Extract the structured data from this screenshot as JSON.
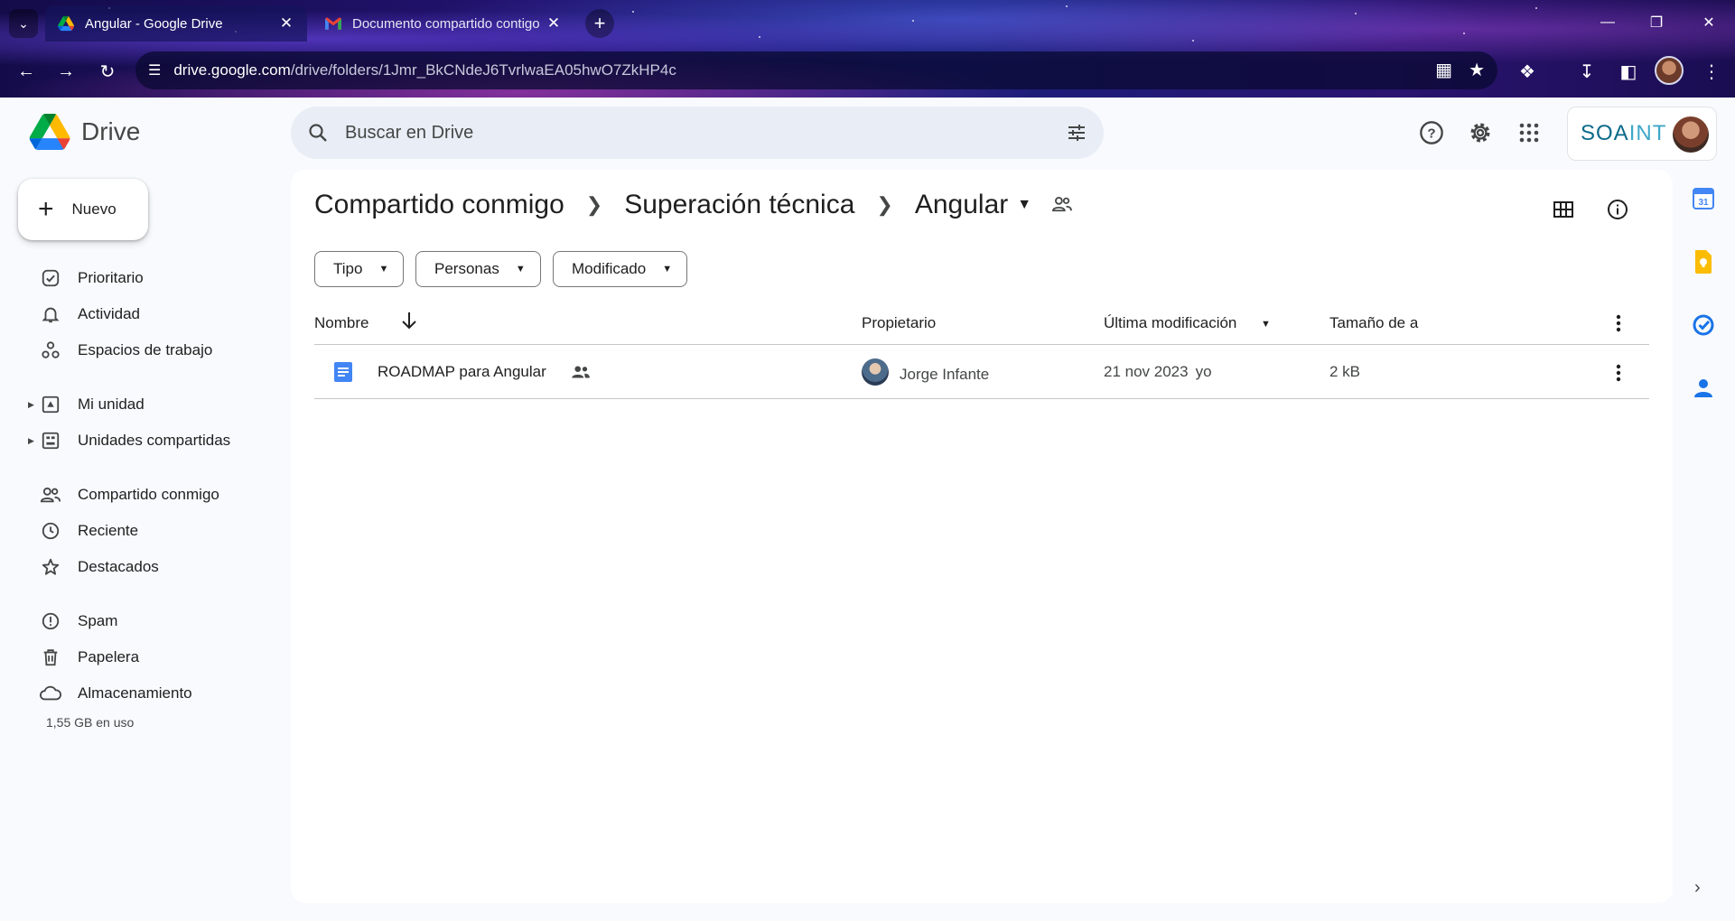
{
  "browser": {
    "tabs": [
      {
        "title": "Angular - Google Drive",
        "active": true
      },
      {
        "title": "Documento compartido contigo",
        "active": false
      }
    ],
    "url_host": "drive.google.com",
    "url_path": "/drive/folders/1Jmr_BkCNdeJ6TvrlwaEA05hwO7ZkHP4c"
  },
  "app": {
    "name": "Drive",
    "search_placeholder": "Buscar en Drive",
    "account_brand": "SOAINT",
    "account_brand_a": "SOA",
    "account_brand_b": "INT"
  },
  "sidebar": {
    "new_label": "Nuevo",
    "items": [
      {
        "label": "Prioritario",
        "icon": "priority-icon"
      },
      {
        "label": "Actividad",
        "icon": "bell-icon"
      },
      {
        "label": "Espacios de trabajo",
        "icon": "workspaces-icon"
      },
      {
        "label": "Mi unidad",
        "icon": "my-drive-icon"
      },
      {
        "label": "Unidades compartidas",
        "icon": "shared-drives-icon"
      },
      {
        "label": "Compartido conmigo",
        "icon": "people-icon"
      },
      {
        "label": "Reciente",
        "icon": "clock-icon"
      },
      {
        "label": "Destacados",
        "icon": "star-icon"
      },
      {
        "label": "Spam",
        "icon": "spam-icon"
      },
      {
        "label": "Papelera",
        "icon": "trash-icon"
      },
      {
        "label": "Almacenamiento",
        "icon": "cloud-icon"
      }
    ],
    "storage_used": "1,55 GB en uso"
  },
  "breadcrumb": [
    {
      "label": "Compartido conmigo"
    },
    {
      "label": "Superación técnica"
    },
    {
      "label": "Angular"
    }
  ],
  "filters": [
    {
      "label": "Tipo"
    },
    {
      "label": "Personas"
    },
    {
      "label": "Modificado"
    }
  ],
  "table": {
    "columns": {
      "name": "Nombre",
      "owner": "Propietario",
      "modified": "Última modificación",
      "size": "Tamaño de a"
    },
    "rows": [
      {
        "name": "ROADMAP para Angular",
        "owner": "Jorge Infante",
        "modified_date": "21 nov 2023",
        "modified_by": "yo",
        "size": "2 kB"
      }
    ]
  },
  "colors": {
    "accent_blue": "#0b57d0",
    "doc_blue": "#4285f4",
    "panel_bg": "#f8fafd",
    "search_bg": "#e9eef6"
  }
}
